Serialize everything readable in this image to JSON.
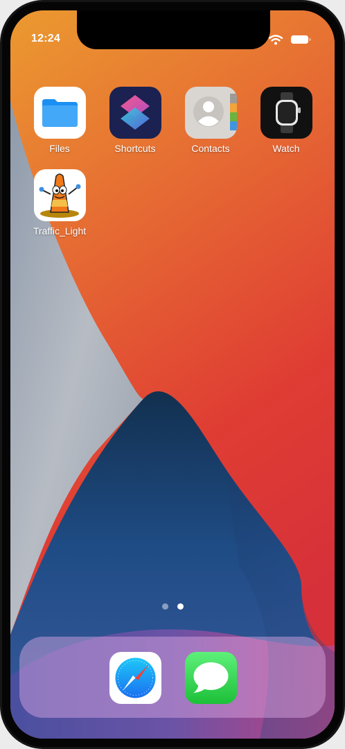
{
  "status_bar": {
    "time": "12:24",
    "icons": [
      "wifi-icon",
      "battery-icon"
    ]
  },
  "home_screen": {
    "apps": [
      {
        "label": "Files",
        "icon": "files-icon"
      },
      {
        "label": "Shortcuts",
        "icon": "shortcuts-icon"
      },
      {
        "label": "Contacts",
        "icon": "contacts-icon"
      },
      {
        "label": "Watch",
        "icon": "watch-icon"
      },
      {
        "label": "Traffic_Light",
        "icon": "traffic-cone-icon"
      }
    ],
    "page_indicator": {
      "pages": 2,
      "current": 2
    }
  },
  "dock": {
    "apps": [
      {
        "icon": "safari-icon"
      },
      {
        "icon": "messages-icon"
      }
    ]
  },
  "colors": {
    "wallpaper_orange": "#e98b31",
    "wallpaper_red": "#db3c33",
    "wallpaper_navy": "#1f4d86",
    "wallpaper_gray": "#a9b1bd",
    "dock_tint": "#e1aae6"
  }
}
